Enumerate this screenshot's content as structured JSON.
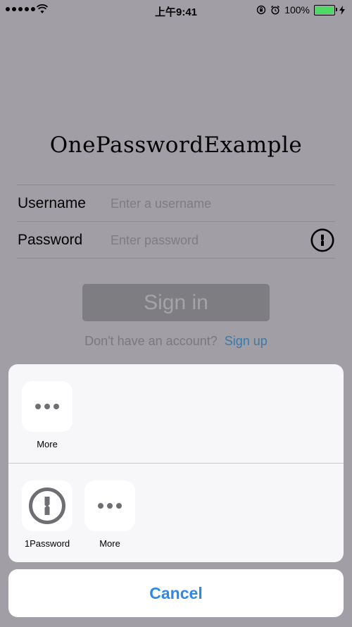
{
  "status_bar": {
    "time": "上午9:41",
    "battery_percent": "100%",
    "battery_level": 1.0
  },
  "app": {
    "title": "OnePasswordExample"
  },
  "form": {
    "username_label": "Username",
    "username_placeholder": "Enter a username",
    "password_label": "Password",
    "password_placeholder": "Enter password",
    "signin_label": "Sign in",
    "signup_prompt": "Don't have an account?",
    "signup_link": "Sign up"
  },
  "share_sheet": {
    "top_row": [
      {
        "label": "More",
        "icon": "more-icon"
      }
    ],
    "bottom_row": [
      {
        "label": "1Password",
        "icon": "onepassword-icon"
      },
      {
        "label": "More",
        "icon": "more-icon"
      }
    ],
    "cancel_label": "Cancel"
  },
  "colors": {
    "dim_background": "#a19fa5",
    "accent": "#2f87e6",
    "link": "#3a79a8"
  }
}
